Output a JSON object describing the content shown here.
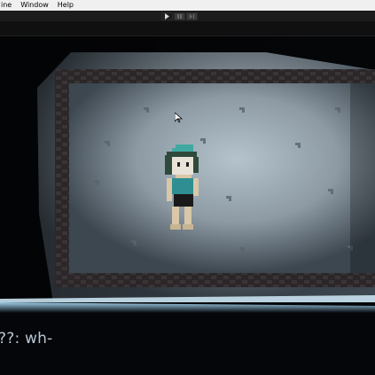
{
  "menu": {
    "items": [
      "ine",
      "Window",
      "Help"
    ]
  },
  "toolbar": {
    "play_icon": "play-icon",
    "pause_icon": "pause-icon",
    "step_icon": "step-icon"
  },
  "dialogue": {
    "text": "??: wh-"
  },
  "colors": {
    "wall": "#8d9aa4",
    "frame": "#2e2a2a",
    "hair": "#2f6f66",
    "cap": "#3fa9a1",
    "dialogue_text": "#b8c7d4"
  }
}
